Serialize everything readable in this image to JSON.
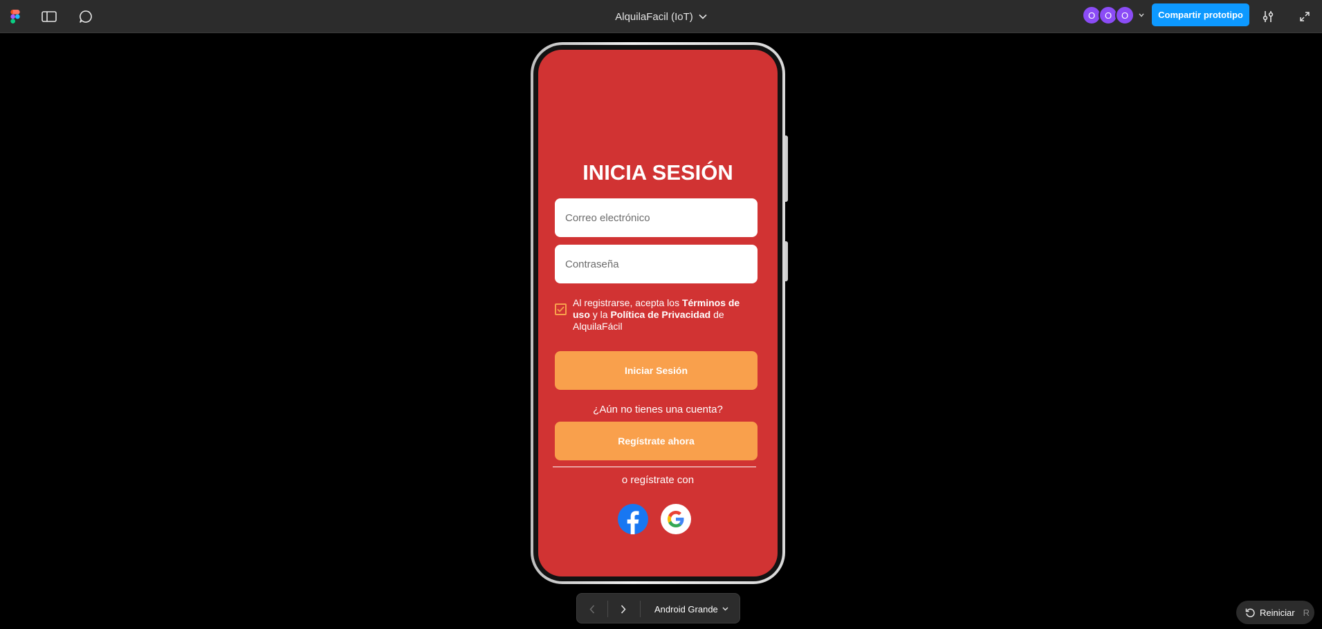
{
  "toolbar": {
    "file_title": "AlquilaFacil (IoT)",
    "avatars": [
      "O",
      "O",
      "O"
    ],
    "share_label": "Compartir prototipo"
  },
  "screen": {
    "title": "INICIA SESIÓN",
    "email_placeholder": "Correo electrónico",
    "password_placeholder": "Contraseña",
    "terms_prefix": "Al registrarse, acepta los ",
    "terms_link": "Términos de uso",
    "terms_middle": " y la ",
    "privacy_link": "Política de Privacidad",
    "terms_suffix": " de AlquilaFácil",
    "login_label": "Iniciar Sesión",
    "no_account": "¿Aún no tienes una cuenta?",
    "register_label": "Regístrate ahora",
    "or_register": "o regístrate con"
  },
  "bottom_nav": {
    "device": "Android Grande"
  },
  "restart": {
    "label": "Reiniciar",
    "shortcut": "R"
  },
  "colors": {
    "screen_bg": "#d13333",
    "button": "#f9a04c",
    "share_button": "#0d99ff",
    "avatar": "#8b4cf6"
  }
}
